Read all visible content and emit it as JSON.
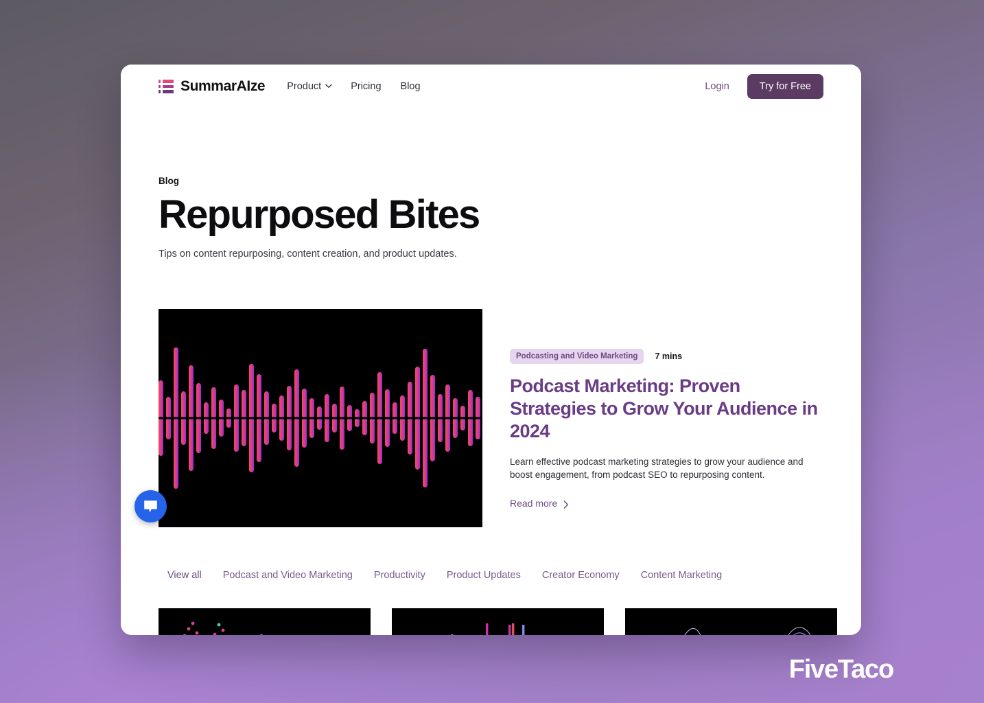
{
  "nav": {
    "brand": "SummarAIze",
    "links": [
      {
        "label": "Product",
        "has_dropdown": true
      },
      {
        "label": "Pricing",
        "has_dropdown": false
      },
      {
        "label": "Blog",
        "has_dropdown": false
      }
    ],
    "login_label": "Login",
    "cta_label": "Try for Free"
  },
  "hero": {
    "eyebrow": "Blog",
    "title": "Repurposed Bites",
    "subtitle": "Tips on content repurposing, content creation, and product updates."
  },
  "featured": {
    "tag": "Podcasting and Video Marketing",
    "read_time": "7 mins",
    "title": "Podcast Marketing: Proven Strategies to Grow Your Audience in 2024",
    "description": "Learn effective podcast marketing strategies to grow your audience and boost engagement, from podcast SEO to repurposing content.",
    "read_more": "Read more"
  },
  "filters": [
    {
      "label": "View all",
      "active": true
    },
    {
      "label": "Podcast and Video Marketing",
      "active": false
    },
    {
      "label": "Productivity",
      "active": false
    },
    {
      "label": "Product Updates",
      "active": false
    },
    {
      "label": "Creator Economy",
      "active": false
    },
    {
      "label": "Content Marketing",
      "active": false
    }
  ],
  "grid_cards": [
    {
      "visual": "dotted-peaks"
    },
    {
      "visual": "color-spikes"
    },
    {
      "visual": "contour-waves"
    }
  ],
  "chat_widget": {
    "icon": "chat-bubble-icon"
  },
  "watermark": "FiveTaco",
  "colors": {
    "accent_purple": "#6a3c85",
    "cta_bg": "#5c3b63",
    "tag_bg": "#e5d6ee",
    "tag_text": "#6d4680",
    "link_purple": "#7a5a8c",
    "chat_blue": "#2563eb",
    "logo_pink": "#e04a7d",
    "logo_magenta": "#a93f86",
    "logo_purple": "#6c3a78"
  }
}
